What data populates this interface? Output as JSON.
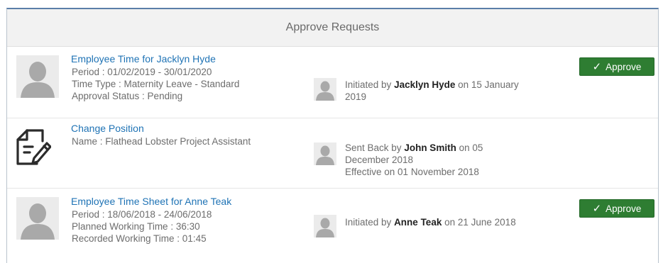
{
  "panel": {
    "title": "Approve Requests"
  },
  "requests": [
    {
      "title": "Employee Time for Jacklyn Hyde",
      "details": [
        "Period : 01/02/2019 - 30/01/2020",
        "Time Type : Maternity Leave - Standard",
        "Approval Status : Pending"
      ],
      "status_prefix": "Initiated by",
      "person": "Jacklyn Hyde",
      "status_suffix": "on 15 January 2019",
      "extra_line": "",
      "action": "Approve"
    },
    {
      "title": "Change Position",
      "details": [
        "Name : Flathead Lobster Project Assistant"
      ],
      "status_prefix": "Sent Back by",
      "person": "John Smith",
      "status_suffix": "on 05 December 2018",
      "extra_line": "Effective on 01 November 2018",
      "action": ""
    },
    {
      "title": "Employee Time Sheet for Anne Teak",
      "details": [
        "Period : 18/06/2018 - 24/06/2018",
        "Planned Working Time : 36:30",
        "Recorded Working Time : 01:45"
      ],
      "status_prefix": "Initiated by",
      "person": "Anne Teak",
      "status_suffix": "on 21 June 2018",
      "extra_line": "",
      "action": "Approve"
    }
  ],
  "icons": {
    "avatar": "user-avatar-icon",
    "document": "document-edit-icon",
    "check": "✓"
  },
  "colors": {
    "link": "#1f73b5",
    "approve": "#2e7d32",
    "header_border": "#5b7ea8"
  }
}
